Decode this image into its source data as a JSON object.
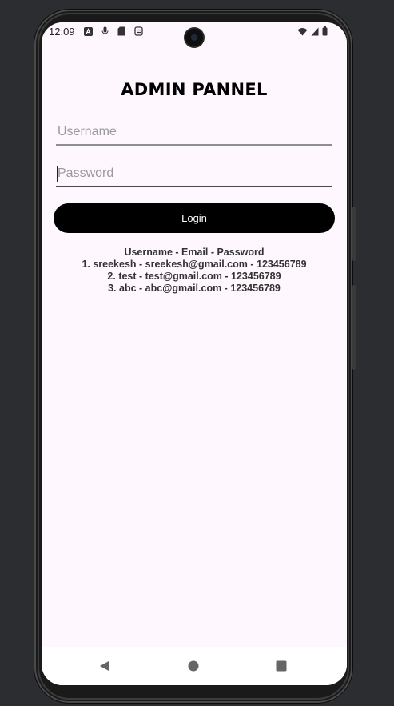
{
  "status_bar": {
    "time": "12:09",
    "left_icons": [
      "a-icon",
      "mic-icon",
      "sd-card-icon",
      "sync-icon"
    ],
    "right_icons": [
      "wifi-icon",
      "signal-icon",
      "battery-icon"
    ]
  },
  "screen": {
    "title": "ADMIN PANNEL",
    "username_placeholder": "Username",
    "password_placeholder": "Password",
    "login_label": "Login",
    "credentials_header": "Username - Email - Password",
    "credentials": [
      "1. sreekesh - sreekesh@gmail.com - 123456789",
      "2. test - test@gmail.com - 123456789",
      "3. abc - abc@gmail.com - 123456789"
    ]
  },
  "nav": {
    "icons": [
      "back-icon",
      "home-icon",
      "recents-icon"
    ]
  },
  "colors": {
    "page_background": "#2b2d31",
    "screen_background": "#fef7fd",
    "button_background": "#000000",
    "button_text": "#ffffff"
  }
}
